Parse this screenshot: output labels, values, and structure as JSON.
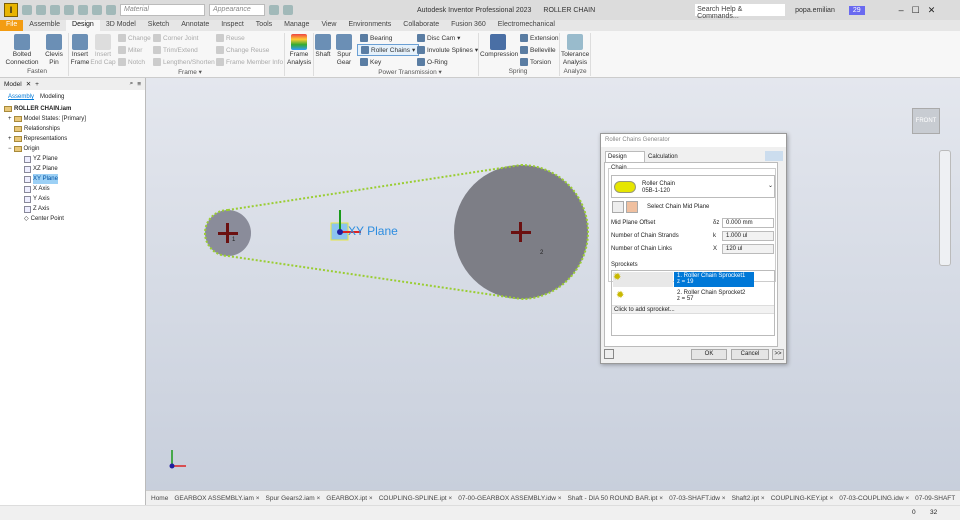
{
  "titlebar": {
    "app_title": "Autodesk Inventor Professional 2023",
    "doc_title": "ROLLER CHAIN",
    "material": "Material",
    "appearance": "Appearance",
    "search_placeholder": "Search Help & Commands...",
    "user": "popa.emilian",
    "notifications": "29",
    "logo": "I"
  },
  "tabs": [
    "File",
    "Assemble",
    "Design",
    "3D Model",
    "Sketch",
    "Annotate",
    "Inspect",
    "Tools",
    "Manage",
    "View",
    "Environments",
    "Collaborate",
    "Fusion 360",
    "Electromechanical"
  ],
  "ribbon": {
    "fasten": {
      "label": "Fasten",
      "bolted": "Bolted Connection",
      "clevis": "Clevis Pin"
    },
    "frame": {
      "label": "Frame ▾",
      "insert": "Insert Frame",
      "insert_end": "Insert End Cap",
      "change": "Change",
      "miter": "Miter",
      "notch": "Notch",
      "corner": "Corner Joint",
      "trim": "Trim/Extend",
      "lengthen": "Lengthen/Shorten",
      "reuse": "Reuse",
      "change_reuse": "Change Reuse",
      "member_info": "Frame Member Info"
    },
    "frame_analysis": "Frame Analysis",
    "power": {
      "label": "Power Transmission ▾",
      "shaft": "Shaft",
      "spur": "Spur Gear",
      "bearing": "Bearing",
      "roller": "Roller Chains",
      "key": "Key",
      "disc_cam": "Disc Cam",
      "splines": "Involute Splines",
      "oring": "O-Ring"
    },
    "spring": {
      "label": "Spring",
      "compression": "Compression",
      "extension": "Extension",
      "belleville": "Belleville",
      "torsion": "Torsion"
    },
    "analyze": {
      "label": "Analyze",
      "tolerance": "Tolerance Analysis"
    }
  },
  "browser": {
    "tab": "Model",
    "sub_tabs": [
      "Assembly",
      "Modeling"
    ],
    "tree": [
      "ROLLER CHAIN.iam",
      "Model States: [Primary]",
      "Relationships",
      "Representations",
      "Origin",
      "YZ Plane",
      "XZ Plane",
      "XY Plane",
      "X Axis",
      "Y Axis",
      "Z Axis",
      "Center Point"
    ]
  },
  "viewport": {
    "plane_label": "XY Plane",
    "sprocket1": "1",
    "sprocket2": "2",
    "viewcube": "FRONT"
  },
  "dialog": {
    "title": "Roller Chains Generator",
    "tabs": [
      "Design",
      "Calculation"
    ],
    "chain_section": "Chain",
    "chain_name": "Roller Chain",
    "chain_code": "05B-1-120",
    "select_plane": "Select Chain Mid Plane",
    "fields": [
      {
        "label": "Mid Plane Offset",
        "sym": "δz",
        "value": "0.000 mm"
      },
      {
        "label": "Number of Chain Strands",
        "sym": "k",
        "value": "1.000 ul"
      },
      {
        "label": "Number of Chain Links",
        "sym": "X",
        "value": "120 ul"
      }
    ],
    "sprockets_section": "Sprockets",
    "sprockets": [
      {
        "name": "1. Roller Chain Sprocket1",
        "z": "z = 19"
      },
      {
        "name": "2. Roller Chain Sprocket2",
        "z": "z = 57"
      }
    ],
    "add_sprocket": "Click to add sprocket...",
    "ok": "OK",
    "cancel": "Cancel",
    "more": ">>"
  },
  "doc_tabs": [
    "Home",
    "GEARBOX ASSEMBLY.iam ×",
    "Spur Gears2.iam ×",
    "GEARBOX.ipt ×",
    "COUPLING-SPLINE.ipt ×",
    "07-00-GEARBOX ASSEMBLY.idw ×",
    "Shaft - DIA 50 ROUND BAR.ipt ×",
    "07-03-SHAFT.idw ×",
    "Shaft2.ipt ×",
    "COUPLING-KEY.ipt ×",
    "07-03-COUPLING.idw ×",
    "07-09-SHAFT"
  ],
  "status": {
    "a": "0",
    "b": "32"
  },
  "colors": {
    "accent": "#0078d7",
    "file_tab": "#f39c12",
    "chain": "#9acd32"
  }
}
